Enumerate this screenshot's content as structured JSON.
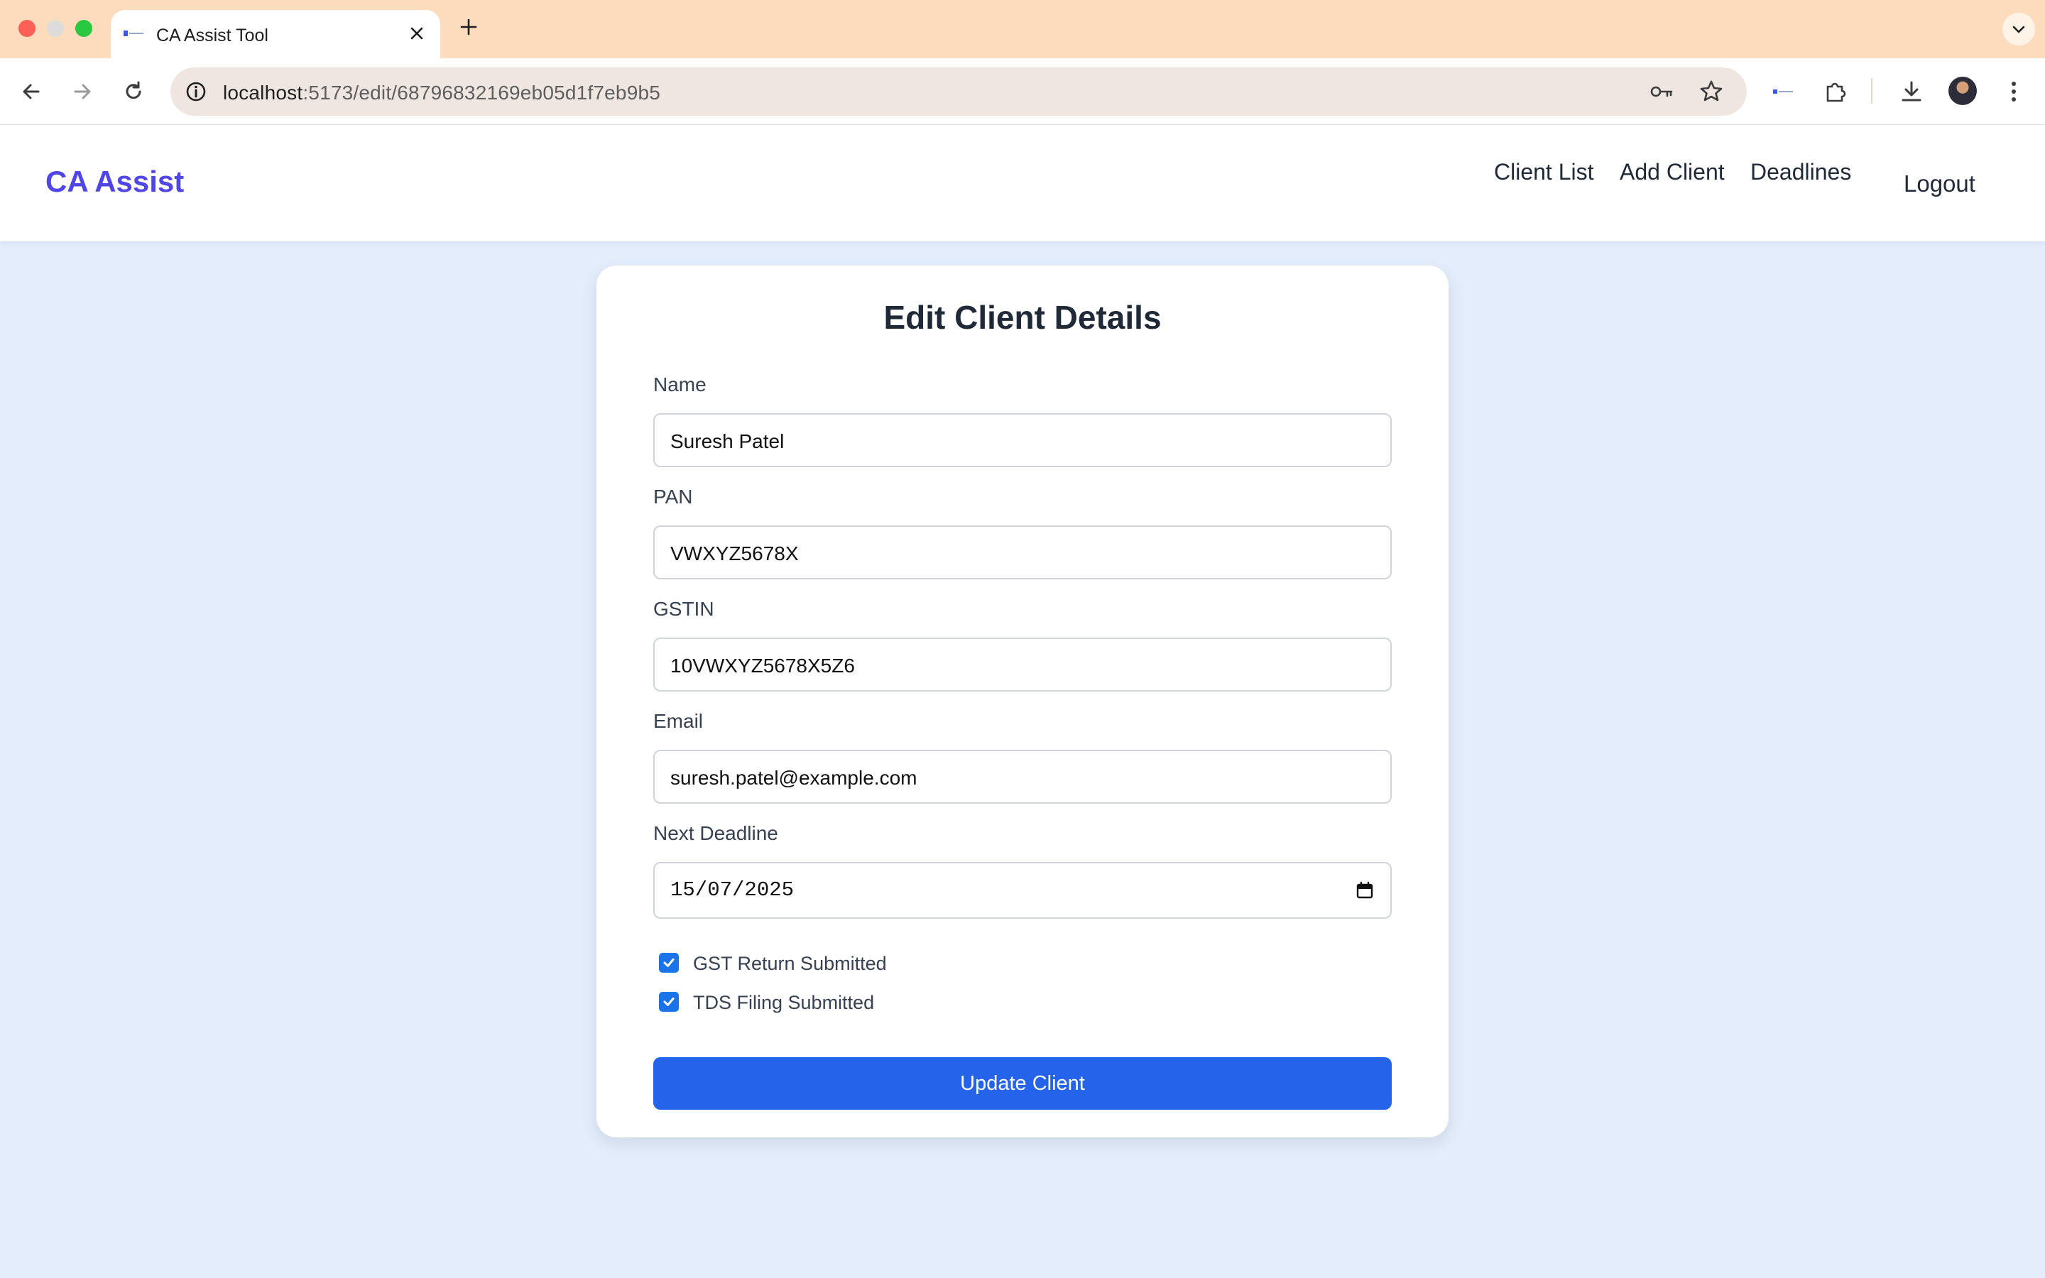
{
  "browser": {
    "tab_title": "CA Assist Tool",
    "url_host": "localhost",
    "url_path": ":5173/edit/68796832169eb05d1f7eb9b5"
  },
  "navbar": {
    "brand": "CA Assist",
    "links": [
      "Client List",
      "Add Client",
      "Deadlines"
    ],
    "logout": "Logout",
    "brand_color": "#4f46e5"
  },
  "form": {
    "title": "Edit Client Details",
    "fields": [
      {
        "label": "Name",
        "value": "Suresh Patel"
      },
      {
        "label": "PAN",
        "value": "VWXYZ5678X"
      },
      {
        "label": "GSTIN",
        "value": "10VWXYZ5678X5Z6"
      },
      {
        "label": "Email",
        "value": "suresh.patel@example.com"
      },
      {
        "label": "Next Deadline",
        "value": "15/07/2025"
      }
    ],
    "checkboxes": [
      {
        "label": "GST Return Submitted",
        "checked": true
      },
      {
        "label": "TDS Filing Submitted",
        "checked": true
      }
    ],
    "submit_label": "Update Client",
    "submit_color": "#2563eb"
  },
  "icons": {
    "toolbar": [
      "back-arrow-icon",
      "forward-arrow-icon",
      "reload-icon",
      "site-info-icon",
      "password-key-icon",
      "bookmark-star-icon",
      "extension-favicon-icon",
      "puzzle-extensions-icon",
      "download-icon",
      "profile-avatar",
      "more-menu-icon"
    ]
  }
}
